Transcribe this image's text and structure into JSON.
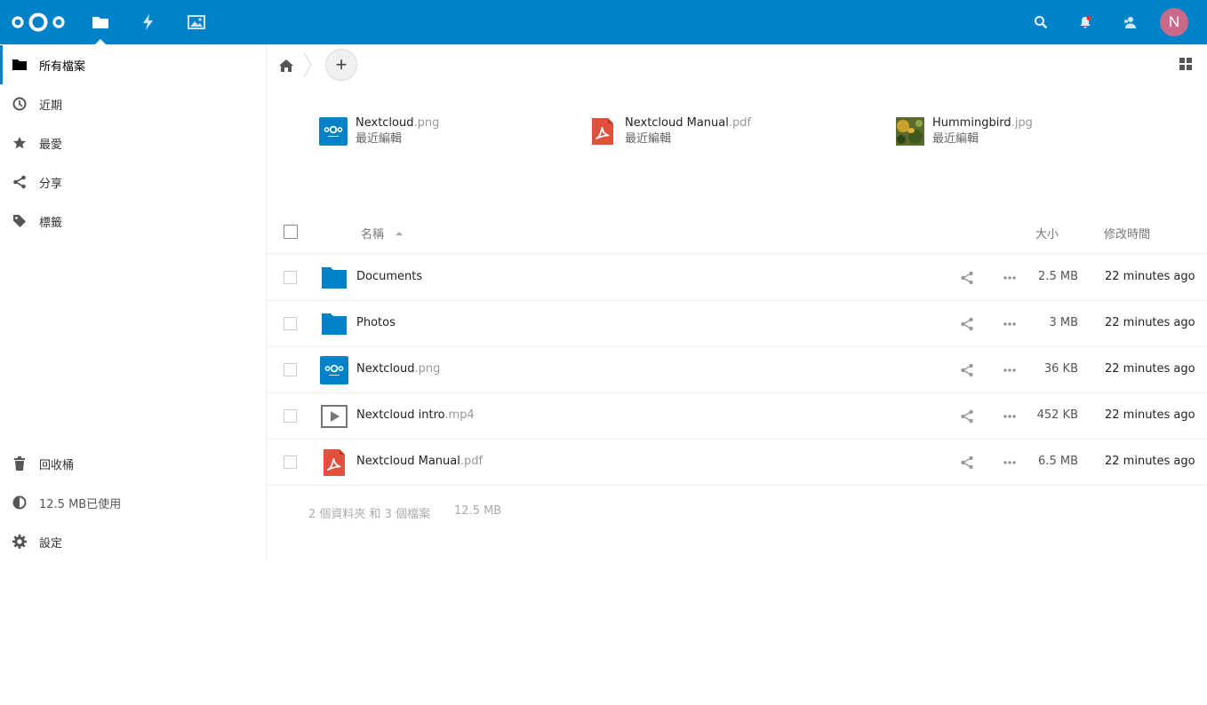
{
  "header": {
    "logo": "nextcloud-logo",
    "apps": [
      {
        "icon": "folder-icon",
        "active": true
      },
      {
        "icon": "activity-icon",
        "active": false
      },
      {
        "icon": "gallery-icon",
        "active": false
      }
    ],
    "right_icons": [
      "search-icon",
      "notifications-icon",
      "contacts-icon"
    ],
    "avatar_letter": "N",
    "color": "#0082c9"
  },
  "sidebar": {
    "items": [
      {
        "label": "所有檔案",
        "icon": "folder-icon",
        "active": true
      },
      {
        "label": "近期",
        "icon": "clock-icon"
      },
      {
        "label": "最愛",
        "icon": "star-icon"
      },
      {
        "label": "分享",
        "icon": "share-icon"
      },
      {
        "label": "標籤",
        "icon": "tag-icon"
      }
    ],
    "bottom": {
      "trash": "回收桶",
      "quota": "12.5 MB已使用",
      "settings": "設定"
    }
  },
  "toolbar": {
    "new_label": "+"
  },
  "recent": [
    {
      "name": "Nextcloud",
      "ext": ".png",
      "subtitle": "最近編輯",
      "icon": "nextcloud-thumb"
    },
    {
      "name": "Nextcloud Manual",
      "ext": ".pdf",
      "subtitle": "最近編輯",
      "icon": "pdf-icon"
    },
    {
      "name": "Hummingbird",
      "ext": ".jpg",
      "subtitle": "最近編輯",
      "icon": "photo-thumb"
    }
  ],
  "list": {
    "headers": {
      "name": "名稱",
      "size": "大小",
      "modified": "修改時間"
    },
    "rows": [
      {
        "name": "Documents",
        "ext": "",
        "size": "2.5 MB",
        "modified": "22 minutes ago",
        "icon": "folder"
      },
      {
        "name": "Photos",
        "ext": "",
        "size": "3 MB",
        "modified": "22 minutes ago",
        "icon": "folder"
      },
      {
        "name": "Nextcloud",
        "ext": ".png",
        "size": "36 KB",
        "modified": "22 minutes ago",
        "icon": "nextcloud"
      },
      {
        "name": "Nextcloud intro",
        "ext": ".mp4",
        "size": "452 KB",
        "modified": "22 minutes ago",
        "icon": "video"
      },
      {
        "name": "Nextcloud Manual",
        "ext": ".pdf",
        "size": "6.5 MB",
        "modified": "22 minutes ago",
        "icon": "pdf"
      }
    ],
    "summary": {
      "counts": "2 個資料夾 和 3 個檔案",
      "total": "12.5 MB"
    }
  }
}
